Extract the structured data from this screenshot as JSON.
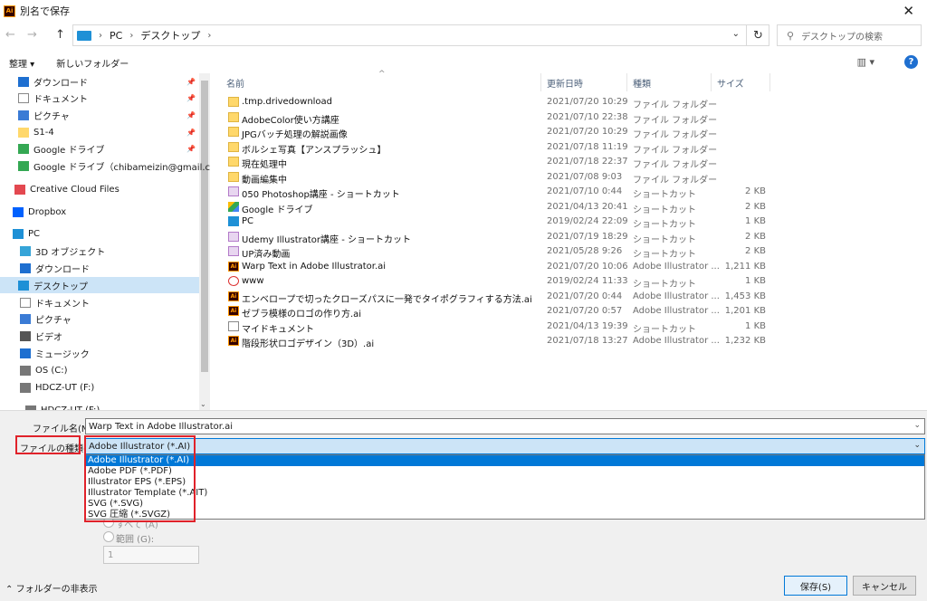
{
  "window": {
    "title": "別名で保存",
    "app_icon": "Ai",
    "close": "✕"
  },
  "nav": {
    "back": "←",
    "forward": "→",
    "up": "↑",
    "breadcrumb": [
      "PC",
      "デスクトップ"
    ],
    "search_placeholder": "デスクトップの検索"
  },
  "toolbar": {
    "organize": "整理 ▾",
    "new_folder": "新しいフォルダー",
    "help": "?"
  },
  "sidebar": {
    "items": [
      {
        "label": "ダウンロード",
        "icon": "download-icon",
        "pinned": true
      },
      {
        "label": "ドキュメント",
        "icon": "document-icon",
        "pinned": true
      },
      {
        "label": "ピクチャ",
        "icon": "picture-icon",
        "pinned": true
      },
      {
        "label": "S1-4",
        "icon": "folder-icon",
        "pinned": true
      },
      {
        "label": "Google ドライブ",
        "icon": "google-drive-icon",
        "pinned": true
      },
      {
        "label": "Google ドライブ（chibameizin@gmail.com",
        "icon": "google-drive-icon",
        "pinned": false
      },
      {
        "label": "Creative Cloud Files",
        "icon": "creative-cloud-icon",
        "pinned": false
      },
      {
        "label": "Dropbox",
        "icon": "dropbox-icon",
        "pinned": false
      },
      {
        "label": "PC",
        "icon": "pc-icon",
        "pinned": false
      },
      {
        "label": "3D オブジェクト",
        "icon": "3d-objects-icon",
        "pinned": false
      },
      {
        "label": "ダウンロード",
        "icon": "download-icon",
        "pinned": false
      },
      {
        "label": "デスクトップ",
        "icon": "desktop-icon",
        "pinned": false,
        "selected": true
      },
      {
        "label": "ドキュメント",
        "icon": "document-icon",
        "pinned": false
      },
      {
        "label": "ピクチャ",
        "icon": "picture-icon",
        "pinned": false
      },
      {
        "label": "ビデオ",
        "icon": "video-icon",
        "pinned": false
      },
      {
        "label": "ミュージック",
        "icon": "music-icon",
        "pinned": false
      },
      {
        "label": "OS (C:)",
        "icon": "drive-icon",
        "pinned": false
      },
      {
        "label": "HDCZ-UT (F:)",
        "icon": "drive-icon",
        "pinned": false
      },
      {
        "label": "HDCZ-UT (F:)",
        "icon": "drive-icon",
        "pinned": false
      }
    ]
  },
  "columns": {
    "name": "名前",
    "date": "更新日時",
    "type": "種類",
    "size": "サイズ"
  },
  "files": [
    {
      "name": ".tmp.drivedownload",
      "date": "2021/07/20 10:29",
      "type": "ファイル フォルダー",
      "size": "",
      "icon": "folder"
    },
    {
      "name": "AdobeColor使い方講座",
      "date": "2021/07/10 22:38",
      "type": "ファイル フォルダー",
      "size": "",
      "icon": "folder"
    },
    {
      "name": "JPGバッチ処理の解説画像",
      "date": "2021/07/20 10:29",
      "type": "ファイル フォルダー",
      "size": "",
      "icon": "folder"
    },
    {
      "name": "ボルシェ写真【アンスプラッシュ】",
      "date": "2021/07/18 11:19",
      "type": "ファイル フォルダー",
      "size": "",
      "icon": "folder"
    },
    {
      "name": "現在処理中",
      "date": "2021/07/18 22:37",
      "type": "ファイル フォルダー",
      "size": "",
      "icon": "folder"
    },
    {
      "name": "動画編集中",
      "date": "2021/07/08 9:03",
      "type": "ファイル フォルダー",
      "size": "",
      "icon": "folder"
    },
    {
      "name": "050 Photoshop講座 - ショートカット",
      "date": "2021/07/10 0:44",
      "type": "ショートカット",
      "size": "2 KB",
      "icon": "pdf"
    },
    {
      "name": "Google ドライブ",
      "date": "2021/04/13 20:41",
      "type": "ショートカット",
      "size": "2 KB",
      "icon": "drive"
    },
    {
      "name": "PC",
      "date": "2019/02/24 22:09",
      "type": "ショートカット",
      "size": "1 KB",
      "icon": "pc"
    },
    {
      "name": "Udemy Illustrator講座 - ショートカット",
      "date": "2021/07/19 18:29",
      "type": "ショートカット",
      "size": "2 KB",
      "icon": "pdf"
    },
    {
      "name": "UP済み動画",
      "date": "2021/05/28 9:26",
      "type": "ショートカット",
      "size": "2 KB",
      "icon": "pdf"
    },
    {
      "name": "Warp Text in Adobe Illustrator.ai",
      "date": "2021/07/20 10:06",
      "type": "Adobe Illustrator ...",
      "size": "1,211 KB",
      "icon": "ai"
    },
    {
      "name": "www",
      "date": "2019/02/24 11:33",
      "type": "ショートカット",
      "size": "1 KB",
      "icon": "www"
    },
    {
      "name": "エンベロープで切ったクローズパスに一発でタイポグラフィする方法.ai",
      "date": "2021/07/20 0:44",
      "type": "Adobe Illustrator ...",
      "size": "1,453 KB",
      "icon": "ai"
    },
    {
      "name": "ゼブラ模様のロゴの作り方.ai",
      "date": "2021/07/20 0:57",
      "type": "Adobe Illustrator ...",
      "size": "1,201 KB",
      "icon": "ai"
    },
    {
      "name": "マイドキュメント",
      "date": "2021/04/13 19:39",
      "type": "ショートカット",
      "size": "1 KB",
      "icon": "doc"
    },
    {
      "name": "階段形状ロゴデザイン（3D）.ai",
      "date": "2021/07/18 13:27",
      "type": "Adobe Illustrator ...",
      "size": "1,232 KB",
      "icon": "ai"
    }
  ],
  "form": {
    "filename_label": "ファイル名(N):",
    "filename_value": "Warp Text in Adobe Illustrator.ai",
    "filetype_label": "ファイルの種類(T)",
    "filetype_value": "Adobe Illustrator (*.AI)",
    "filetype_options": [
      "Adobe Illustrator (*.AI)",
      "Adobe PDF (*.PDF)",
      "Illustrator EPS (*.EPS)",
      "Illustrator Template (*.AIT)",
      "SVG (*.SVG)",
      "SVG 圧縮 (*.SVGZ)"
    ],
    "all_option": "すべて (A)",
    "range_option": "範囲 (G):",
    "range_value": "1"
  },
  "footer": {
    "hide_folders": "フォルダーの非表示",
    "save": "保存(S)",
    "cancel": "キャンセル"
  },
  "colors": {
    "highlight": "#e0222a",
    "selection": "#0078d7",
    "accent_light": "#cce4f7"
  }
}
